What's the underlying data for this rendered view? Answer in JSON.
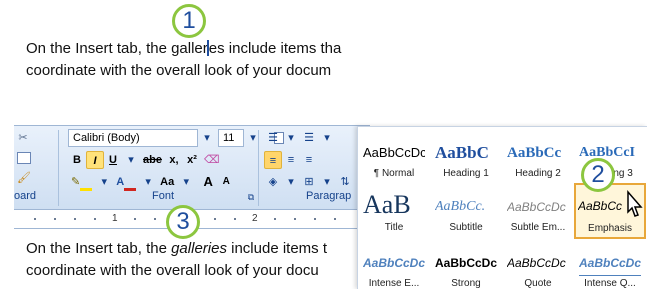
{
  "callouts": [
    "1",
    "2",
    "3"
  ],
  "top_text": {
    "line1_pre": "On the Insert tab, the galler",
    "line1_post": "es include items tha",
    "line2": "coordinate with the overall look of your docum"
  },
  "bottom_text": {
    "line1_pre": "On the Insert tab, the ",
    "line1_em": "galleries",
    "line1_post": " include items t",
    "line2": "coordinate with the overall look of your docu"
  },
  "ribbon": {
    "font_name": "Calibri (Body)",
    "font_size": "11",
    "bold": "B",
    "italic": "I",
    "underline": "U",
    "strike": "abe",
    "subscript": "x,",
    "superscript": "x²",
    "font_color": "A",
    "change_case": "Aa",
    "grow": "A",
    "shrink": "A",
    "clipboard_label": "oard",
    "font_label": "Font",
    "paragraph_label": "Paragrap"
  },
  "ruler": {
    "numbers": [
      "1",
      "2"
    ]
  },
  "gallery": {
    "tiles": [
      {
        "sample": "AaBbCcDc",
        "name": "¶ Normal"
      },
      {
        "sample": "AaBbC",
        "name": "Heading 1"
      },
      {
        "sample": "AaBbCc",
        "name": "Heading 2"
      },
      {
        "sample": "AaBbCcI",
        "name": "Heading 3"
      },
      {
        "sample": "AaB",
        "name": "Title"
      },
      {
        "sample": "AaBbCc.",
        "name": "Subtitle"
      },
      {
        "sample": "AaBbCcDc",
        "name": "Subtle Em..."
      },
      {
        "sample": "AaBbCc",
        "name": "Emphasis"
      },
      {
        "sample": "AaBbCcDc",
        "name": "Intense E..."
      },
      {
        "sample": "AaBbCcDc",
        "name": "Strong"
      },
      {
        "sample": "AaBbCcDc",
        "name": "Quote"
      },
      {
        "sample": "AaBbCcDc",
        "name": "Intense Q..."
      }
    ]
  },
  "colors": {
    "callout_ring": "#8cc63f",
    "callout_text": "#1f4e9e",
    "heading_blue": "#1f5fa8",
    "selected_tile": "#e8a73a",
    "highlight": "#ffe27a",
    "font_color_red": "#d1261f"
  }
}
